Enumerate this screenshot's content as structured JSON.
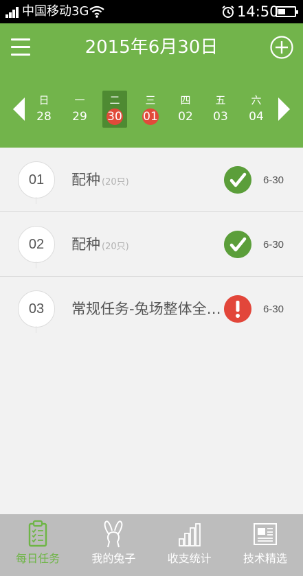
{
  "statusbar": {
    "carrier": "中国移动3G",
    "time": "14:50"
  },
  "header": {
    "title": "2015年6月30日",
    "prev_icon": "triangle-left-icon",
    "next_icon": "triangle-right-icon"
  },
  "week": {
    "days": [
      {
        "weekday": "日",
        "date": "28",
        "selected": false,
        "marked": false
      },
      {
        "weekday": "一",
        "date": "29",
        "selected": false,
        "marked": false
      },
      {
        "weekday": "二",
        "date": "30",
        "selected": true,
        "marked": true
      },
      {
        "weekday": "三",
        "date": "01",
        "selected": false,
        "marked": true
      },
      {
        "weekday": "四",
        "date": "02",
        "selected": false,
        "marked": false
      },
      {
        "weekday": "五",
        "date": "03",
        "selected": false,
        "marked": false
      },
      {
        "weekday": "六",
        "date": "04",
        "selected": false,
        "marked": false
      }
    ]
  },
  "tasks": [
    {
      "index": "01",
      "name": "配种",
      "qty": "(20只)",
      "status": "done",
      "date": "6-30"
    },
    {
      "index": "02",
      "name": "配种",
      "qty": "(20只)",
      "status": "done",
      "date": "6-30"
    },
    {
      "index": "03",
      "name": "常规任务-兔场整体全面消毒",
      "qty": "",
      "status": "overdue",
      "date": "6-30"
    }
  ],
  "nav": {
    "items": [
      {
        "label": "每日任务",
        "icon": "clipboard-icon",
        "active": true
      },
      {
        "label": "我的兔子",
        "icon": "rabbit-icon",
        "active": false
      },
      {
        "label": "收支统计",
        "icon": "bar-chart-icon",
        "active": false
      },
      {
        "label": "技术精选",
        "icon": "newspaper-icon",
        "active": false
      }
    ]
  },
  "colors": {
    "header_green": "#72b44b",
    "selected_day": "#4e8a32",
    "marked_red": "#e14a3a",
    "done_green": "#5b9e3a",
    "warn_red": "#e2463a",
    "nav_bg": "#bdbdbd",
    "nav_active": "#6eb546"
  }
}
